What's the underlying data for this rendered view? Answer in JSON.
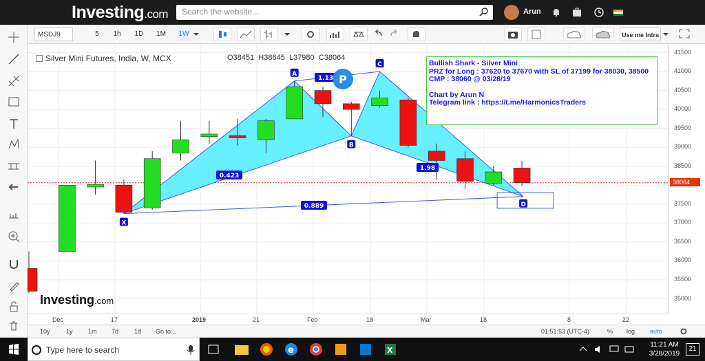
{
  "header": {
    "logo_main": "Investing",
    "logo_suffix": ".com",
    "search_placeholder": "Search the website...",
    "user_name": "Arun"
  },
  "toolbar": {
    "symbol": "MSDJ9",
    "intervals": [
      "5",
      "1h",
      "1D",
      "1M",
      "1W"
    ],
    "active_interval": "1W",
    "use_me_label": "Use me Intra"
  },
  "chart": {
    "title": "Silver Mini Futures, India, W, MCX",
    "ohlc_open": "O38451",
    "ohlc_high": "H38645",
    "ohlc_low": "L37980",
    "ohlc_close": "C38064",
    "last_price": "38064",
    "watermark_main": "Investing",
    "watermark_suffix": ".com"
  },
  "chart_data": {
    "type": "candlestick",
    "y_ticks": [
      "41500",
      "41000",
      "40500",
      "40000",
      "39500",
      "39000",
      "38500",
      "38000",
      "37500",
      "37000",
      "36500",
      "36000",
      "35500",
      "35000"
    ],
    "ylim": [
      34700,
      41700
    ],
    "x_ticks": [
      "Dec",
      "17",
      "2019",
      "21",
      "Feb",
      "18",
      "Mar",
      "18",
      "8",
      "22"
    ],
    "candles": [
      {
        "o": 35800,
        "c": 35200,
        "h": 36250,
        "l": 35150
      },
      {
        "o": 36250,
        "c": 38000,
        "h": 38000,
        "l": 36250
      },
      {
        "o": 37950,
        "c": 38020,
        "h": 38650,
        "l": 37750
      },
      {
        "o": 38000,
        "c": 37280,
        "h": 38150,
        "l": 37250
      },
      {
        "o": 37400,
        "c": 38700,
        "h": 38900,
        "l": 37350
      },
      {
        "o": 38850,
        "c": 39200,
        "h": 39700,
        "l": 38650
      },
      {
        "o": 39280,
        "c": 39350,
        "h": 39700,
        "l": 39100
      },
      {
        "o": 39310,
        "c": 39250,
        "h": 39750,
        "l": 39050
      },
      {
        "o": 39200,
        "c": 39700,
        "h": 39750,
        "l": 38850
      },
      {
        "o": 39750,
        "c": 40600,
        "h": 40750,
        "l": 39750
      },
      {
        "o": 40500,
        "c": 40150,
        "h": 40600,
        "l": 39800
      },
      {
        "o": 40150,
        "c": 40000,
        "h": 40200,
        "l": 39300
      },
      {
        "o": 40100,
        "c": 40300,
        "h": 40500,
        "l": 40050
      },
      {
        "o": 40250,
        "c": 39050,
        "h": 40300,
        "l": 39000
      },
      {
        "o": 38900,
        "c": 38650,
        "h": 39100,
        "l": 38150
      },
      {
        "o": 38700,
        "c": 38100,
        "h": 38900,
        "l": 37900
      },
      {
        "o": 38050,
        "c": 38350,
        "h": 38500,
        "l": 38000
      },
      {
        "o": 38451,
        "c": 38064,
        "h": 38645,
        "l": 37980
      }
    ],
    "pattern_labels": {
      "X": "X",
      "A": "A",
      "B": "B",
      "C": "C",
      "D": "D",
      "P": "P"
    },
    "ratios": {
      "xab": "0.423",
      "abc": "1.13",
      "bcd": "1.98",
      "xad": "0.889"
    }
  },
  "annotation": {
    "line1": "Bullish Shark  - Silver Mini",
    "line2": "PRZ for Long  : 37620 to 37670 with SL of 37199 for 38030, 38500",
    "line3": "CMP : 38060 @ 03/28/19",
    "line4": "Chart by Arun N",
    "line5": "Telegram link : https://t.me/HarmonicsTraders"
  },
  "bottom": {
    "ranges": [
      "10y",
      "1y",
      "1m",
      "7d",
      "1d",
      "Go to..."
    ],
    "clock": "01:51:53 (UTC-4)",
    "pct": "%",
    "log": "log",
    "auto": "auto"
  },
  "taskbar": {
    "search_placeholder": "Type here to search",
    "time": "11:21 AM",
    "date": "3/28/2019",
    "notifications": "21"
  },
  "colors": {
    "up": "#22dd22",
    "down": "#ee1111",
    "pattern_fill": "#66f0ff",
    "pattern_stroke": "#4455ee",
    "label_bg": "#1111dd"
  }
}
